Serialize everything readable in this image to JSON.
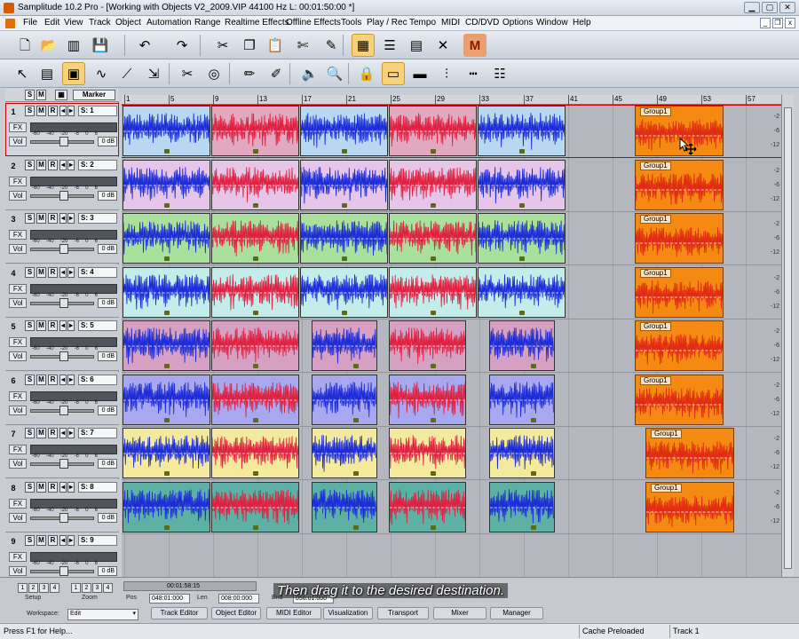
{
  "window": {
    "title": "Samplitude 10.2 Pro - [Working with Objects V2_2009.VIP   44100 Hz L: 00:01:50:00 *]"
  },
  "menu": [
    "File",
    "Edit",
    "View",
    "Track",
    "Object",
    "Automation",
    "Range",
    "Realtime Effects",
    "Offline Effects",
    "Tools",
    "Play / Rec",
    "Tempo",
    "MIDI",
    "CD/DVD",
    "Options",
    "Window",
    "Help"
  ],
  "toolbar1": [
    {
      "name": "new-project-icon",
      "glyph": "🗋"
    },
    {
      "name": "open-project-icon",
      "glyph": "📂"
    },
    {
      "name": "import-audio-icon",
      "glyph": "▥"
    },
    {
      "name": "save-icon",
      "glyph": "💾"
    },
    {
      "name": "undo-icon",
      "glyph": "↶"
    },
    {
      "name": "redo-icon",
      "glyph": "↷"
    },
    {
      "name": "cut-icon",
      "glyph": "✂"
    },
    {
      "name": "copy-icon",
      "glyph": "❐"
    },
    {
      "name": "paste-icon",
      "glyph": "📋"
    },
    {
      "name": "cut-range-icon",
      "glyph": "✄"
    },
    {
      "name": "marker-pen-icon",
      "glyph": "✎"
    },
    {
      "name": "snap-grid-icon",
      "glyph": "▦"
    },
    {
      "name": "object-stack-icon",
      "glyph": "☰"
    },
    {
      "name": "track-view-icon",
      "glyph": "▤"
    },
    {
      "name": "crossfade-icon",
      "glyph": "✕"
    },
    {
      "name": "mixer-icon",
      "glyph": "M"
    }
  ],
  "toolbar2": [
    {
      "name": "pointer-tool-icon",
      "glyph": "↖"
    },
    {
      "name": "range-tool-icon",
      "glyph": "▤"
    },
    {
      "name": "object-mode-icon",
      "glyph": "▣"
    },
    {
      "name": "curve-tool-icon",
      "glyph": "∿"
    },
    {
      "name": "volume-curve-icon",
      "glyph": "⟋"
    },
    {
      "name": "pencil-mode-icon",
      "glyph": "⇲"
    },
    {
      "name": "scissors-tool-icon",
      "glyph": "✂"
    },
    {
      "name": "scrub-tool-icon",
      "glyph": "◎"
    },
    {
      "name": "pen-tool-icon",
      "glyph": "✏"
    },
    {
      "name": "brush-tool-icon",
      "glyph": "✐"
    },
    {
      "name": "speaker-tool-icon",
      "glyph": "🔈"
    },
    {
      "name": "zoom-tool-icon",
      "glyph": "🔍"
    },
    {
      "name": "object-lock-icon",
      "glyph": "🔒"
    },
    {
      "name": "loop-object-icon",
      "glyph": "▭"
    },
    {
      "name": "group-object-icon",
      "glyph": "▬"
    },
    {
      "name": "split-object-icon",
      "glyph": "⫶"
    },
    {
      "name": "dotted-line-icon",
      "glyph": "┅"
    },
    {
      "name": "align-objects-icon",
      "glyph": "☷"
    }
  ],
  "header_buttons": {
    "s": "S",
    "m": "M",
    "grid": "▦",
    "marker": "Marker"
  },
  "tracks": [
    {
      "num": "1",
      "name": "S: 1",
      "db": "0 dB",
      "colors": [
        "#4aa3e6",
        "#e68aa8",
        "#4aa3e6",
        "#e68aa8",
        "#4aa3e6"
      ],
      "bg": "#b8d7f0"
    },
    {
      "num": "2",
      "name": "S: 2",
      "db": "0 dB",
      "colors": [
        "#d7a7d9",
        "#d7a7d9",
        "#d7a7d9",
        "#d7a7d9",
        "#d7a7d9"
      ],
      "bg": "#e6c6e8"
    },
    {
      "num": "3",
      "name": "S: 3",
      "db": "0 dB",
      "colors": [
        "#78cc6a",
        "#78cc6a",
        "#78cc6a",
        "#78cc6a",
        "#78cc6a"
      ],
      "bg": "#a8e09c"
    },
    {
      "num": "4",
      "name": "S: 4",
      "db": "0 dB",
      "colors": [
        "#9ae0d8",
        "#9ae0d8",
        "#9ae0d8",
        "#9ae0d8",
        "#9ae0d8"
      ],
      "bg": "#c4ecea"
    },
    {
      "num": "5",
      "name": "S: 5",
      "db": "0 dB",
      "colors": [
        "#c07ca8",
        "#c07ca8",
        "#c07ca8",
        "#c07ca8",
        "#c07ca8"
      ],
      "bg": "#d6a0c2"
    },
    {
      "num": "6",
      "name": "S: 6",
      "db": "0 dB",
      "colors": [
        "#8a8ae6",
        "#8a8ae6",
        "#8a8ae6",
        "#8a8ae6",
        "#8a8ae6"
      ],
      "bg": "#a8a8f0"
    },
    {
      "num": "7",
      "name": "S: 7",
      "db": "0 dB",
      "colors": [
        "#efe07a",
        "#efe07a",
        "#efe07a",
        "#efe07a",
        "#efe07a"
      ],
      "bg": "#f4ea9e"
    },
    {
      "num": "8",
      "name": "S: 8",
      "db": "0 dB",
      "colors": [
        "#3c9a8c",
        "#3c9a8c",
        "#3c9a8c",
        "#3c9a8c",
        "#3c9a8c"
      ],
      "bg": "#5cb0a4"
    },
    {
      "num": "9",
      "name": "S: 9",
      "db": "0 dB",
      "colors": [],
      "bg": ""
    }
  ],
  "track_buttons": {
    "s": "S",
    "m": "M",
    "r": "R",
    "fx": "FX",
    "vol": "Vol",
    "scale": [
      "-60",
      "-40",
      "-20",
      "-6",
      "0",
      "6"
    ]
  },
  "ruler": [
    "1",
    "5",
    "9",
    "13",
    "17",
    "21",
    "25",
    "29",
    "33",
    "37",
    "41",
    "45",
    "49",
    "53",
    "57"
  ],
  "group_label": "Group1",
  "level_marks": [
    "-2",
    "-6",
    "-12"
  ],
  "bottom": {
    "setup": "Setup",
    "zoom": "Zoom",
    "zoom_buttons": [
      "1",
      "2",
      "3",
      "4"
    ],
    "time_position": "00:01:58:15",
    "pos_label": "Pos",
    "pos_value": "048:01:000",
    "len_label": "Len",
    "len_value": "008:00:000",
    "end_label": "End",
    "end_value": "056:01:000",
    "workspace_label": "Workspace:",
    "workspace_value": "Edit",
    "tabs": [
      "Track Editor",
      "Object Editor",
      "MIDI Editor",
      "Visualization",
      "Transport",
      "Mixer",
      "Manager"
    ],
    "subtitle": "Then drag it to the desired destination."
  },
  "status": {
    "help": "Press F1 for Help...",
    "cache": "Cache Preloaded",
    "track": "Track 1"
  }
}
